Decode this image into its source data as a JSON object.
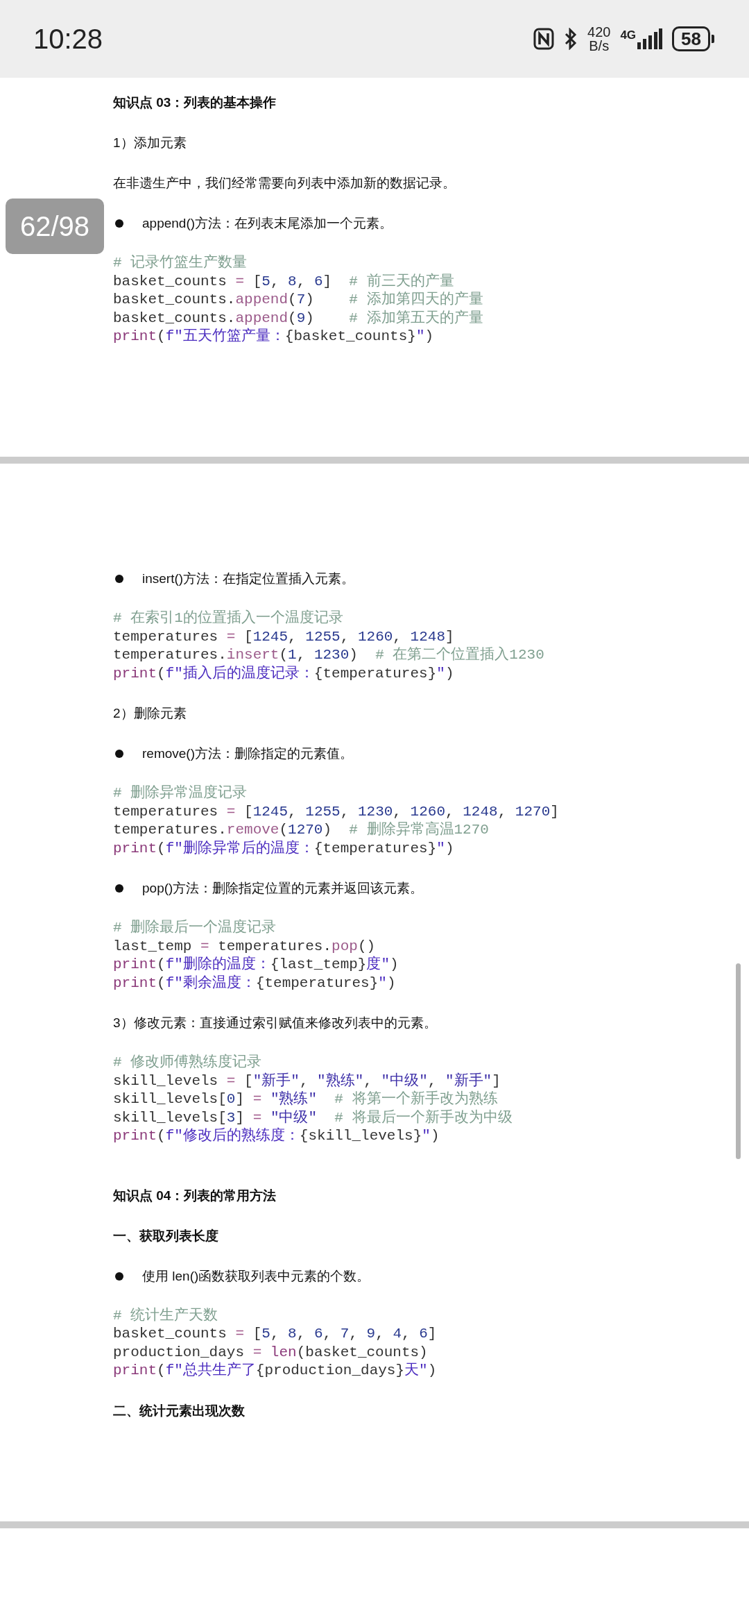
{
  "status_bar": {
    "time": "10:28",
    "speed_value": "420",
    "speed_unit": "B/s",
    "network": "4G",
    "battery": "58"
  },
  "page_indicator": "62/98",
  "pages": [
    {
      "blocks": [
        {
          "kind": "heading",
          "text": "知识点 03：列表的基本操作"
        },
        {
          "kind": "para",
          "text": "1）添加元素"
        },
        {
          "kind": "para",
          "text": "在非遗生产中，我们经常需要向列表中添加新的数据记录。"
        },
        {
          "kind": "bullet",
          "text": "append()方法：在列表末尾添加一个元素。"
        },
        {
          "kind": "code",
          "lines": [
            [
              {
                "kind": "comment",
                "text": "# 记录竹篮生产数量"
              }
            ],
            [
              {
                "kind": "plain",
                "text": "basket_counts "
              },
              {
                "kind": "op",
                "text": "="
              },
              {
                "kind": "plain",
                "text": " ["
              },
              {
                "kind": "num",
                "text": "5"
              },
              {
                "kind": "plain",
                "text": ", "
              },
              {
                "kind": "num",
                "text": "8"
              },
              {
                "kind": "plain",
                "text": ", "
              },
              {
                "kind": "num",
                "text": "6"
              },
              {
                "kind": "plain",
                "text": "]  "
              },
              {
                "kind": "comment",
                "text": "# 前三天的产量"
              }
            ],
            [
              {
                "kind": "plain",
                "text": "basket_counts."
              },
              {
                "kind": "method",
                "text": "append"
              },
              {
                "kind": "plain",
                "text": "("
              },
              {
                "kind": "num",
                "text": "7"
              },
              {
                "kind": "plain",
                "text": ")    "
              },
              {
                "kind": "comment",
                "text": "# 添加第四天的产量"
              }
            ],
            [
              {
                "kind": "plain",
                "text": "basket_counts."
              },
              {
                "kind": "method",
                "text": "append"
              },
              {
                "kind": "plain",
                "text": "("
              },
              {
                "kind": "num",
                "text": "9"
              },
              {
                "kind": "plain",
                "text": ")    "
              },
              {
                "kind": "comment",
                "text": "# 添加第五天的产量"
              }
            ],
            [
              {
                "kind": "builtin",
                "text": "print"
              },
              {
                "kind": "plain",
                "text": "("
              },
              {
                "kind": "fstring",
                "text": "f\"五天竹篮产量："
              },
              {
                "kind": "plain",
                "text": "{basket_counts}"
              },
              {
                "kind": "fstring",
                "text": "\""
              },
              {
                "kind": "plain",
                "text": ")"
              }
            ]
          ]
        }
      ]
    },
    {
      "blocks": [
        {
          "kind": "bullet",
          "text": "insert()方法：在指定位置插入元素。"
        },
        {
          "kind": "code",
          "lines": [
            [
              {
                "kind": "comment",
                "text": "# 在索引1的位置插入一个温度记录"
              }
            ],
            [
              {
                "kind": "plain",
                "text": "temperatures "
              },
              {
                "kind": "op",
                "text": "="
              },
              {
                "kind": "plain",
                "text": " ["
              },
              {
                "kind": "num",
                "text": "1245"
              },
              {
                "kind": "plain",
                "text": ", "
              },
              {
                "kind": "num",
                "text": "1255"
              },
              {
                "kind": "plain",
                "text": ", "
              },
              {
                "kind": "num",
                "text": "1260"
              },
              {
                "kind": "plain",
                "text": ", "
              },
              {
                "kind": "num",
                "text": "1248"
              },
              {
                "kind": "plain",
                "text": "]"
              }
            ],
            [
              {
                "kind": "plain",
                "text": "temperatures."
              },
              {
                "kind": "method",
                "text": "insert"
              },
              {
                "kind": "plain",
                "text": "("
              },
              {
                "kind": "num",
                "text": "1"
              },
              {
                "kind": "plain",
                "text": ", "
              },
              {
                "kind": "num",
                "text": "1230"
              },
              {
                "kind": "plain",
                "text": ")  "
              },
              {
                "kind": "comment",
                "text": "# 在第二个位置插入1230"
              }
            ],
            [
              {
                "kind": "builtin",
                "text": "print"
              },
              {
                "kind": "plain",
                "text": "("
              },
              {
                "kind": "fstring",
                "text": "f\"插入后的温度记录："
              },
              {
                "kind": "plain",
                "text": "{temperatures}"
              },
              {
                "kind": "fstring",
                "text": "\""
              },
              {
                "kind": "plain",
                "text": ")"
              }
            ]
          ]
        },
        {
          "kind": "para",
          "text": "2）删除元素"
        },
        {
          "kind": "bullet",
          "text": "remove()方法：删除指定的元素值。"
        },
        {
          "kind": "code",
          "lines": [
            [
              {
                "kind": "comment",
                "text": "# 删除异常温度记录"
              }
            ],
            [
              {
                "kind": "plain",
                "text": "temperatures "
              },
              {
                "kind": "op",
                "text": "="
              },
              {
                "kind": "plain",
                "text": " ["
              },
              {
                "kind": "num",
                "text": "1245"
              },
              {
                "kind": "plain",
                "text": ", "
              },
              {
                "kind": "num",
                "text": "1255"
              },
              {
                "kind": "plain",
                "text": ", "
              },
              {
                "kind": "num",
                "text": "1230"
              },
              {
                "kind": "plain",
                "text": ", "
              },
              {
                "kind": "num",
                "text": "1260"
              },
              {
                "kind": "plain",
                "text": ", "
              },
              {
                "kind": "num",
                "text": "1248"
              },
              {
                "kind": "plain",
                "text": ", "
              },
              {
                "kind": "num",
                "text": "1270"
              },
              {
                "kind": "plain",
                "text": "]"
              }
            ],
            [
              {
                "kind": "plain",
                "text": "temperatures."
              },
              {
                "kind": "method",
                "text": "remove"
              },
              {
                "kind": "plain",
                "text": "("
              },
              {
                "kind": "num",
                "text": "1270"
              },
              {
                "kind": "plain",
                "text": ")  "
              },
              {
                "kind": "comment",
                "text": "# 删除异常高温1270"
              }
            ],
            [
              {
                "kind": "builtin",
                "text": "print"
              },
              {
                "kind": "plain",
                "text": "("
              },
              {
                "kind": "fstring",
                "text": "f\"删除异常后的温度："
              },
              {
                "kind": "plain",
                "text": "{temperatures}"
              },
              {
                "kind": "fstring",
                "text": "\""
              },
              {
                "kind": "plain",
                "text": ")"
              }
            ]
          ]
        },
        {
          "kind": "bullet",
          "text": "pop()方法：删除指定位置的元素并返回该元素。"
        },
        {
          "kind": "code",
          "lines": [
            [
              {
                "kind": "comment",
                "text": "# 删除最后一个温度记录"
              }
            ],
            [
              {
                "kind": "plain",
                "text": "last_temp "
              },
              {
                "kind": "op",
                "text": "="
              },
              {
                "kind": "plain",
                "text": " temperatures."
              },
              {
                "kind": "method",
                "text": "pop"
              },
              {
                "kind": "plain",
                "text": "()"
              }
            ],
            [
              {
                "kind": "builtin",
                "text": "print"
              },
              {
                "kind": "plain",
                "text": "("
              },
              {
                "kind": "fstring",
                "text": "f\"删除的温度："
              },
              {
                "kind": "plain",
                "text": "{last_temp}"
              },
              {
                "kind": "fstring",
                "text": "度\""
              },
              {
                "kind": "plain",
                "text": ")"
              }
            ],
            [
              {
                "kind": "builtin",
                "text": "print"
              },
              {
                "kind": "plain",
                "text": "("
              },
              {
                "kind": "fstring",
                "text": "f\"剩余温度："
              },
              {
                "kind": "plain",
                "text": "{temperatures}"
              },
              {
                "kind": "fstring",
                "text": "\""
              },
              {
                "kind": "plain",
                "text": ")"
              }
            ]
          ]
        },
        {
          "kind": "para",
          "text": "3）修改元素：直接通过索引赋值来修改列表中的元素。"
        },
        {
          "kind": "code",
          "lines": [
            [
              {
                "kind": "comment",
                "text": "# 修改师傅熟练度记录"
              }
            ],
            [
              {
                "kind": "plain",
                "text": "skill_levels "
              },
              {
                "kind": "op",
                "text": "="
              },
              {
                "kind": "plain",
                "text": " ["
              },
              {
                "kind": "str",
                "text": "\"新手\""
              },
              {
                "kind": "plain",
                "text": ", "
              },
              {
                "kind": "str",
                "text": "\"熟练\""
              },
              {
                "kind": "plain",
                "text": ", "
              },
              {
                "kind": "str",
                "text": "\"中级\""
              },
              {
                "kind": "plain",
                "text": ", "
              },
              {
                "kind": "str",
                "text": "\"新手\""
              },
              {
                "kind": "plain",
                "text": "]"
              }
            ],
            [
              {
                "kind": "plain",
                "text": "skill_levels["
              },
              {
                "kind": "num",
                "text": "0"
              },
              {
                "kind": "plain",
                "text": "] "
              },
              {
                "kind": "op",
                "text": "= "
              },
              {
                "kind": "str",
                "text": "\"熟练\"  "
              },
              {
                "kind": "comment",
                "text": "# 将第一个新手改为熟练"
              }
            ],
            [
              {
                "kind": "plain",
                "text": "skill_levels["
              },
              {
                "kind": "num",
                "text": "3"
              },
              {
                "kind": "plain",
                "text": "] "
              },
              {
                "kind": "op",
                "text": "= "
              },
              {
                "kind": "str",
                "text": "\"中级\"  "
              },
              {
                "kind": "comment",
                "text": "# 将最后一个新手改为中级"
              }
            ],
            [
              {
                "kind": "builtin",
                "text": "print"
              },
              {
                "kind": "plain",
                "text": "("
              },
              {
                "kind": "fstring",
                "text": "f\"修改后的熟练度："
              },
              {
                "kind": "plain",
                "text": "{skill_levels}"
              },
              {
                "kind": "fstring",
                "text": "\""
              },
              {
                "kind": "plain",
                "text": ")"
              }
            ]
          ]
        },
        {
          "kind": "heading",
          "text": "知识点 04：列表的常用方法"
        },
        {
          "kind": "subheading",
          "text": "一、获取列表长度"
        },
        {
          "kind": "bullet",
          "text": "使用 len()函数获取列表中元素的个数。"
        },
        {
          "kind": "code",
          "lines": [
            [
              {
                "kind": "comment",
                "text": "# 统计生产天数"
              }
            ],
            [
              {
                "kind": "plain",
                "text": "basket_counts "
              },
              {
                "kind": "op",
                "text": "="
              },
              {
                "kind": "plain",
                "text": " ["
              },
              {
                "kind": "num",
                "text": "5"
              },
              {
                "kind": "plain",
                "text": ", "
              },
              {
                "kind": "num",
                "text": "8"
              },
              {
                "kind": "plain",
                "text": ", "
              },
              {
                "kind": "num",
                "text": "6"
              },
              {
                "kind": "plain",
                "text": ", "
              },
              {
                "kind": "num",
                "text": "7"
              },
              {
                "kind": "plain",
                "text": ", "
              },
              {
                "kind": "num",
                "text": "9"
              },
              {
                "kind": "plain",
                "text": ", "
              },
              {
                "kind": "num",
                "text": "4"
              },
              {
                "kind": "plain",
                "text": ", "
              },
              {
                "kind": "num",
                "text": "6"
              },
              {
                "kind": "plain",
                "text": "]"
              }
            ],
            [
              {
                "kind": "plain",
                "text": "production_days "
              },
              {
                "kind": "op",
                "text": "= "
              },
              {
                "kind": "builtin",
                "text": "len"
              },
              {
                "kind": "plain",
                "text": "(basket_counts)"
              }
            ],
            [
              {
                "kind": "builtin",
                "text": "print"
              },
              {
                "kind": "plain",
                "text": "("
              },
              {
                "kind": "fstring",
                "text": "f\"总共生产了"
              },
              {
                "kind": "plain",
                "text": "{production_days}"
              },
              {
                "kind": "fstring",
                "text": "天\""
              },
              {
                "kind": "plain",
                "text": ")"
              }
            ]
          ]
        },
        {
          "kind": "subheading",
          "text": "二、统计元素出现次数"
        }
      ]
    }
  ]
}
